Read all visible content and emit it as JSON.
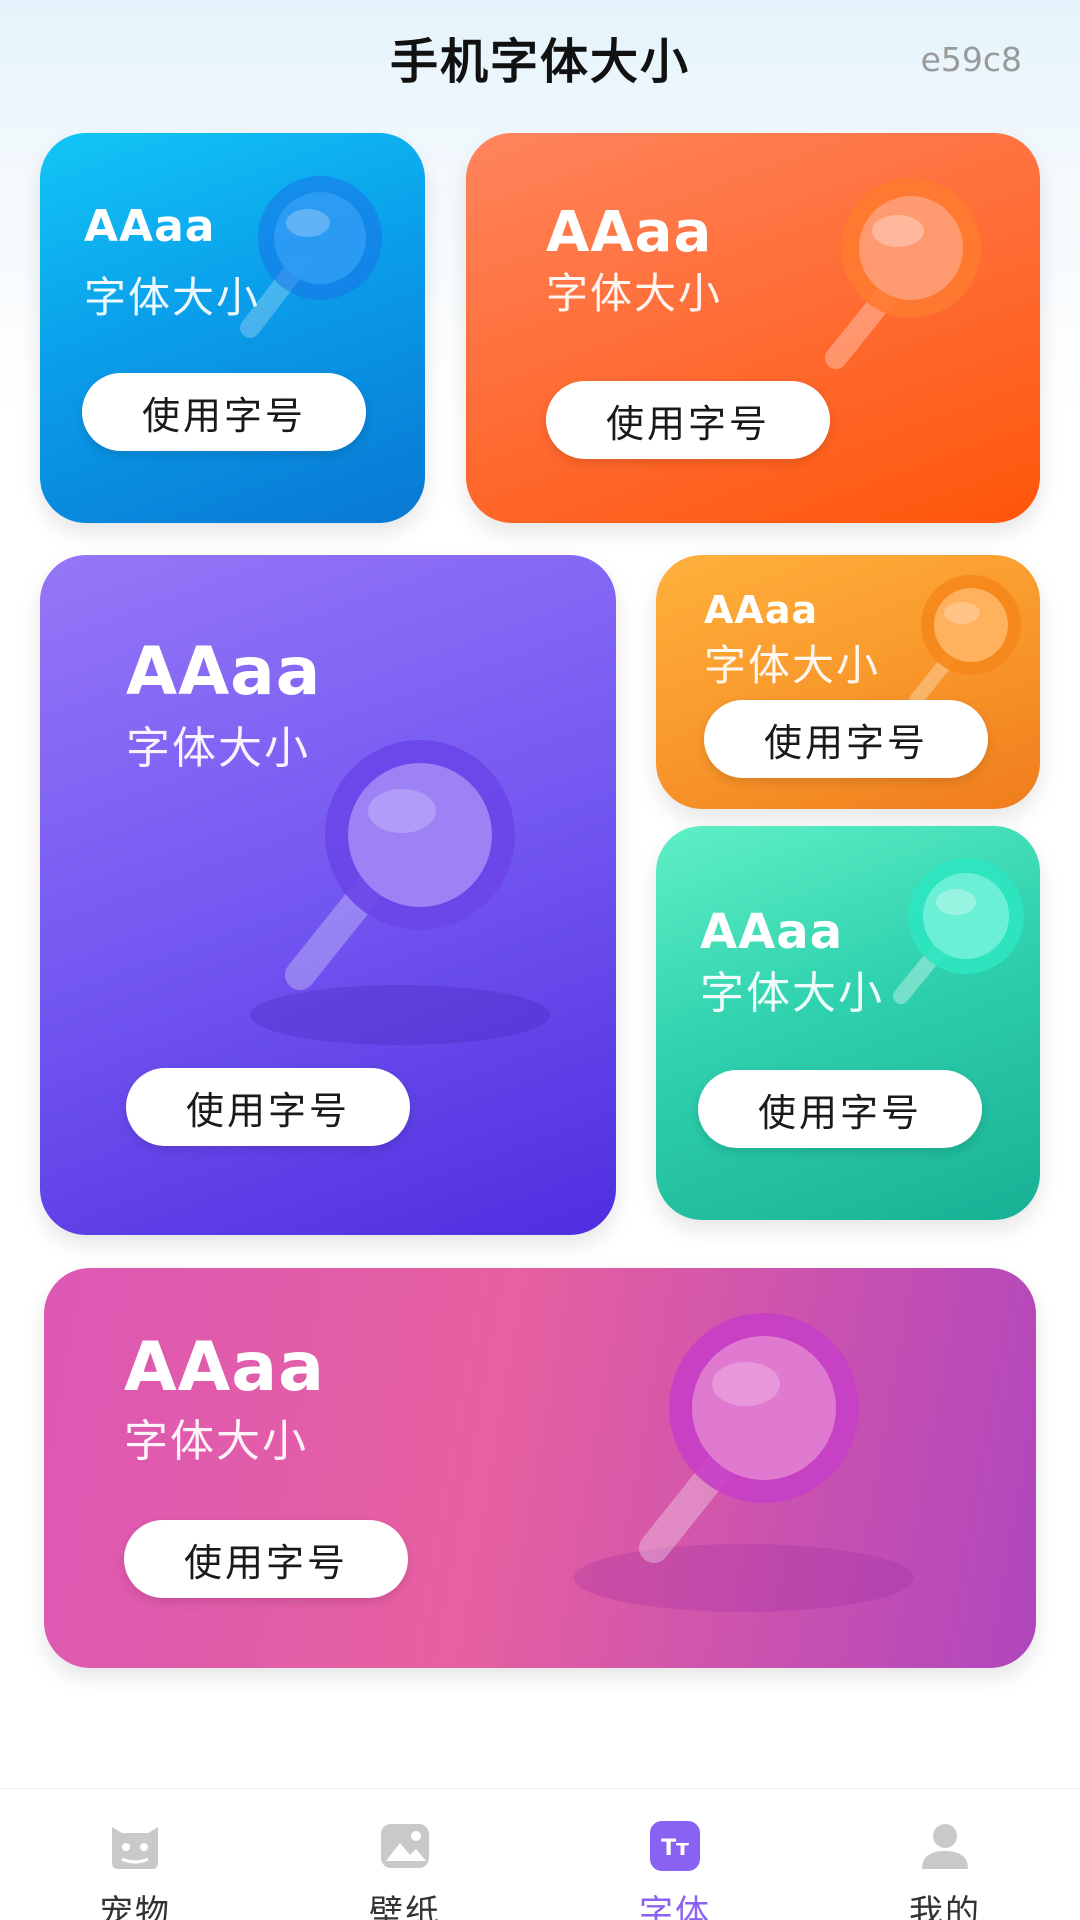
{
  "header": {
    "title": "手机字体大小",
    "corner_code": "e59c8"
  },
  "cards": [
    {
      "sample": "AAaa",
      "subtitle": "字体大小",
      "button": "使用字号"
    },
    {
      "sample": "AAaa",
      "subtitle": "字体大小",
      "button": "使用字号"
    },
    {
      "sample": "AAaa",
      "subtitle": "字体大小",
      "button": "使用字号"
    },
    {
      "sample": "AAaa",
      "subtitle": "字体大小",
      "button": "使用字号"
    },
    {
      "sample": "AAaa",
      "subtitle": "字体大小",
      "button": "使用字号"
    },
    {
      "sample": "AAaa",
      "subtitle": "字体大小",
      "button": "使用字号"
    }
  ],
  "tabs": [
    {
      "label": "宠物",
      "icon": "pet-icon",
      "active": false
    },
    {
      "label": "壁纸",
      "icon": "wallpaper-icon",
      "active": false
    },
    {
      "label": "字体",
      "icon": "font-icon",
      "active": true
    },
    {
      "label": "我的",
      "icon": "profile-icon",
      "active": false
    }
  ],
  "colors": {
    "active_tab": "#8a62f3",
    "card_blue": "#0a9eea",
    "card_orange_red": "#ff6c34",
    "card_purple": "#7357f1",
    "card_orange": "#f8962a",
    "card_teal": "#2fd1ae",
    "card_pink": "#e760a0"
  }
}
